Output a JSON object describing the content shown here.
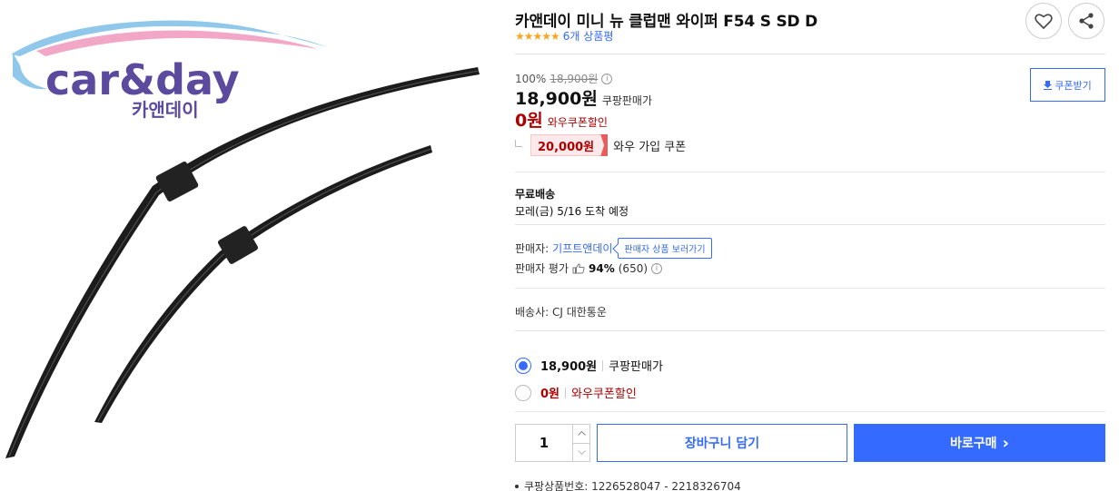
{
  "product": {
    "title": "카앤데이 미니 뉴 클럽맨 와이퍼 F54 S SD D",
    "stars": "★★★★★",
    "review_count_label": "6개 상품평"
  },
  "logo": {
    "brand_en": "car&day",
    "brand_kr": "카앤데이"
  },
  "price": {
    "discount_rate": "100%",
    "original_price": "18,900원",
    "info_icon": "i",
    "sale_price": "18,900원",
    "sale_label": "쿠팡판매가",
    "wow_price": "0원",
    "wow_label": "와우쿠폰할인",
    "coupon_amount": "20,000원",
    "coupon_text": "와우 가입 쿠폰",
    "coupon_button": "쿠폰받기"
  },
  "shipping": {
    "label": "무료배송",
    "arrival": "모레(금) 5/16 도착 예정"
  },
  "seller": {
    "label": "판매자:",
    "name": "기프트앤데이",
    "view_products_button": "판매자 상품 보러가기",
    "rating_label": "판매자 평가",
    "rating_percent": "94%",
    "rating_count": "(650)"
  },
  "carrier": {
    "text": "배송사: CJ 대한통운"
  },
  "options": [
    {
      "price": "18,900원",
      "label": "쿠팡판매가",
      "selected": true
    },
    {
      "price": "0원",
      "label": "와우쿠폰할인",
      "selected": false
    }
  ],
  "purchase": {
    "quantity": "1",
    "cart_button": "장바구니 담기",
    "buy_button": "바로구매",
    "buy_chevron": "›"
  },
  "product_number": {
    "text": "쿠팡상품번호: 1226528047 - 2218326704"
  },
  "colors": {
    "accent": "#346aff",
    "wow_red": "#ae0000",
    "star": "#f5a623"
  },
  "icons": {
    "heart": "heart-icon",
    "share": "share-icon",
    "download": "download-icon",
    "thumb": "thumb-up-icon",
    "info": "info-icon"
  }
}
